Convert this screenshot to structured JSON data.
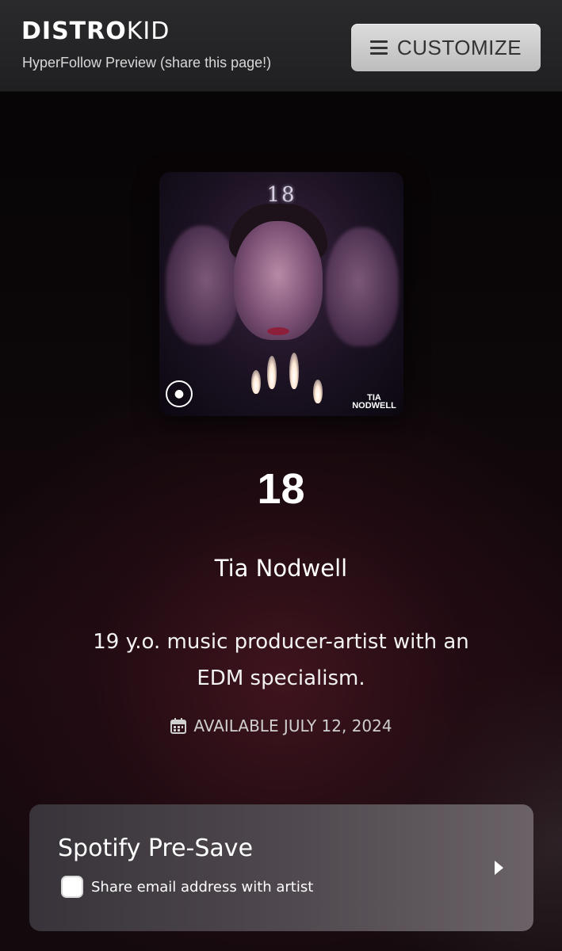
{
  "header": {
    "logo_bold": "DISTRO",
    "logo_light": "KID",
    "subtitle": "HyperFollow Preview (share this page!)",
    "customize_label": "CUSTOMIZE"
  },
  "release": {
    "cover_tiara_text": "18",
    "cover_artist_tag_line1": "TIA",
    "cover_artist_tag_line2": "NODWELL",
    "title": "18",
    "artist": "Tia Nodwell",
    "bio": "19 y.o. music producer-artist with an EDM specialism.",
    "availability": "AVAILABLE JULY 12, 2024"
  },
  "presave": {
    "title": "Spotify Pre-Save",
    "share_label": "Share email address with artist",
    "share_checked": false
  },
  "icons": {
    "menu": "hamburger-icon",
    "calendar": "calendar-icon",
    "arrow": "chevron-right-icon"
  }
}
